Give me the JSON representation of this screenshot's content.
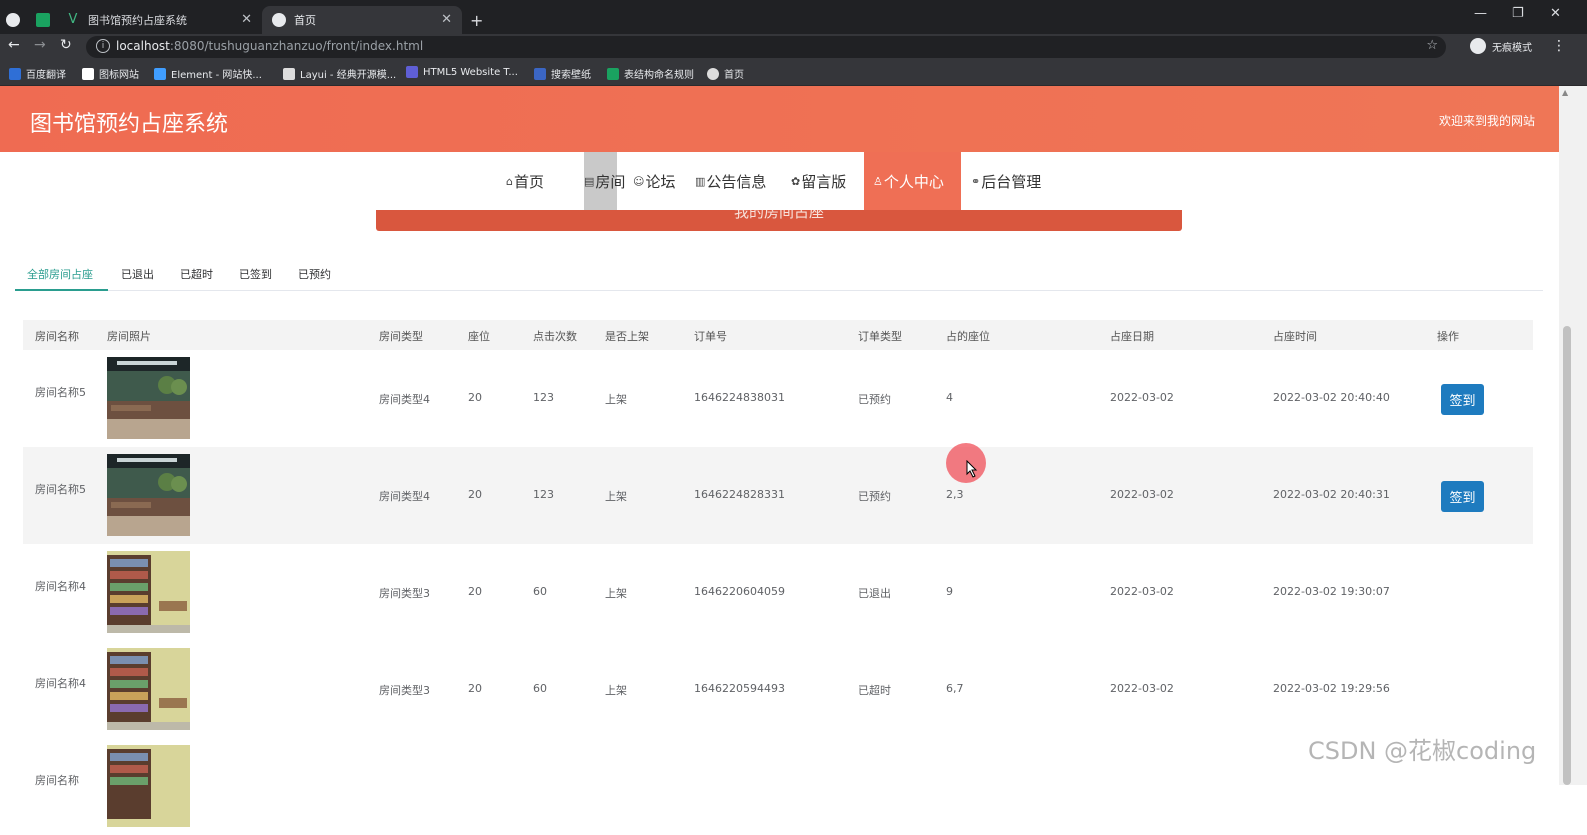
{
  "browser": {
    "tabs": [
      {
        "title": ""
      },
      {
        "title": "图书馆预约占座系统"
      },
      {
        "title": "首页"
      }
    ],
    "new_tab": "+",
    "url_host": "localhost",
    "url_rest": ":8080/tushuguanzhanzuo/front/index.html",
    "incognito_label": "无痕模式",
    "bookmarks": [
      {
        "label": "百度翻译",
        "color": "#2f6fd6"
      },
      {
        "label": "图标网站",
        "color": "#ffffff"
      },
      {
        "label": "Element - 网站快...",
        "color": "#409eff"
      },
      {
        "label": "Layui - 经典开源模...",
        "color": "#dddddd"
      },
      {
        "label": "HTML5 Website T...",
        "color": "#5f5fd6"
      },
      {
        "label": "搜索壁纸",
        "color": "#3b66c4"
      },
      {
        "label": "表结构命名规则",
        "color": "#1aa260"
      },
      {
        "label": "首页",
        "color": "#dddddd"
      }
    ]
  },
  "site": {
    "title": "图书馆预约占座系统",
    "welcome": "欢迎来到我的网站",
    "accent": "#ef6f55"
  },
  "nav": [
    {
      "icon": "⌂",
      "label": "首页"
    },
    {
      "icon": "▤",
      "label": "房间"
    },
    {
      "icon": "☺",
      "label": "论坛"
    },
    {
      "icon": "▥",
      "label": "公告信息"
    },
    {
      "icon": "✿",
      "label": "留言版"
    },
    {
      "icon": "♙",
      "label": "个人中心"
    },
    {
      "icon": "⚭",
      "label": "后台管理"
    }
  ],
  "banner": "我的房间占座",
  "subtabs": [
    "全部房间占座",
    "已退出",
    "已超时",
    "已签到",
    "已预约"
  ],
  "table": {
    "headers": [
      "房间名称",
      "房间照片",
      "房间类型",
      "座位",
      "点击次数",
      "是否上架",
      "订单号",
      "订单类型",
      "占的座位",
      "占座日期",
      "占座时间",
      "操作"
    ],
    "rows": [
      {
        "name": "房间名称5",
        "type": "房间类型4",
        "seats": "20",
        "clicks": "123",
        "listed": "上架",
        "order_no": "1646224838031",
        "order_type": "已预约",
        "seat_taken": "4",
        "date": "2022-03-02",
        "time": "2022-03-02 20:40:40",
        "action": "签到"
      },
      {
        "name": "房间名称5",
        "type": "房间类型4",
        "seats": "20",
        "clicks": "123",
        "listed": "上架",
        "order_no": "1646224828331",
        "order_type": "已预约",
        "seat_taken": "2,3",
        "date": "2022-03-02",
        "time": "2022-03-02 20:40:31",
        "action": "签到"
      },
      {
        "name": "房间名称4",
        "type": "房间类型3",
        "seats": "20",
        "clicks": "60",
        "listed": "上架",
        "order_no": "1646220604059",
        "order_type": "已退出",
        "seat_taken": "9",
        "date": "2022-03-02",
        "time": "2022-03-02 19:30:07",
        "action": ""
      },
      {
        "name": "房间名称4",
        "type": "房间类型3",
        "seats": "20",
        "clicks": "60",
        "listed": "上架",
        "order_no": "1646220594493",
        "order_type": "已超时",
        "seat_taken": "6,7",
        "date": "2022-03-02",
        "time": "2022-03-02 19:29:56",
        "action": ""
      },
      {
        "name": "房间名称",
        "type": "",
        "seats": "",
        "clicks": "",
        "listed": "",
        "order_no": "",
        "order_type": "",
        "seat_taken": "",
        "date": "",
        "time": "",
        "action": ""
      }
    ]
  },
  "watermark": "CSDN @花椒coding"
}
